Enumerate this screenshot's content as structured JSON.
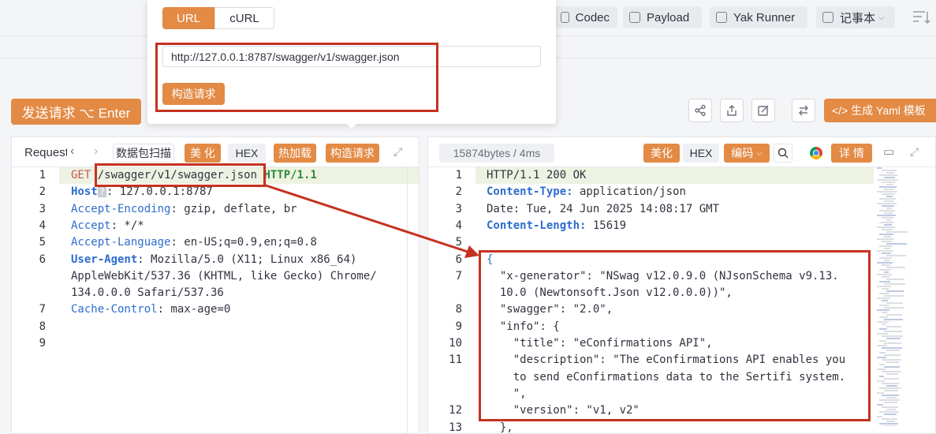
{
  "toolbar": {
    "codec": "Codec",
    "payload": "Payload",
    "yak_runner": "Yak Runner",
    "notebook": "记事本"
  },
  "popup": {
    "tab_url": "URL",
    "tab_curl": "cURL",
    "url_value": "http://127.0.0.1:8787/swagger/v1/swagger.json",
    "build_button": "构造请求"
  },
  "send_button": "发送请求 ⌥ Enter",
  "yaml_button": "</> 生成 Yaml 模板",
  "request_panel": {
    "title": "Request",
    "scan": "数据包扫描",
    "beautify": "美 化",
    "hex": "HEX",
    "hotload": "热加载",
    "build": "构造请求",
    "lines": [
      {
        "n": "1",
        "parts": [
          [
            "GET ",
            "red"
          ],
          [
            "/swagger/v1/swagger.json",
            "plain"
          ],
          [
            " HTTP/1.1",
            "redbold"
          ]
        ]
      },
      {
        "n": "2",
        "parts": [
          [
            "Host",
            "bluebold"
          ],
          [
            "?",
            "badge"
          ],
          [
            ": 127.0.0.1:8787",
            "plain"
          ]
        ]
      },
      {
        "n": "3",
        "parts": [
          [
            "Accept-Encoding",
            "blue"
          ],
          [
            ": gzip, deflate, br",
            "plain"
          ]
        ]
      },
      {
        "n": "4",
        "parts": [
          [
            "Accept",
            "blue"
          ],
          [
            ": */*",
            "plain"
          ]
        ]
      },
      {
        "n": "5",
        "parts": [
          [
            "Accept-Language",
            "blue"
          ],
          [
            ": en-US;q=0.9,en;q=0.8",
            "plain"
          ]
        ]
      },
      {
        "n": "6",
        "parts": [
          [
            "User-Agent",
            "bluebold"
          ],
          [
            ": Mozilla/5.0 (X11; Linux x86_64)",
            "plain"
          ]
        ]
      },
      {
        "n": "",
        "parts": [
          [
            "AppleWebKit/537.36 (KHTML, like Gecko) Chrome/",
            "plain"
          ]
        ]
      },
      {
        "n": "",
        "parts": [
          [
            "134.0.0.0 Safari/537.36",
            "plain"
          ]
        ]
      },
      {
        "n": "7",
        "parts": [
          [
            "Cache-Control",
            "blue"
          ],
          [
            ": max-age=0",
            "plain"
          ]
        ]
      },
      {
        "n": "8",
        "parts": []
      },
      {
        "n": "9",
        "parts": []
      }
    ]
  },
  "response_panel": {
    "size_info": "15874bytes / 4ms",
    "beautify": "美化",
    "hex": "HEX",
    "encode": "编码",
    "details": "详 情",
    "lines": [
      {
        "n": "1",
        "parts": [
          [
            "HTTP/1.1 200 OK",
            "plain"
          ]
        ]
      },
      {
        "n": "2",
        "parts": [
          [
            "Content-Type:",
            "bluebold"
          ],
          [
            " application/json",
            "plain"
          ]
        ]
      },
      {
        "n": "3",
        "parts": [
          [
            "Date: Tue, 24 Jun 2025 14:08:17 GMT",
            "plain"
          ]
        ]
      },
      {
        "n": "4",
        "parts": [
          [
            "Content-Length:",
            "bluebold"
          ],
          [
            " 15619",
            "plain"
          ]
        ]
      },
      {
        "n": "5",
        "parts": []
      },
      {
        "n": "6",
        "parts": [
          [
            "{",
            "blue"
          ]
        ]
      },
      {
        "n": "7",
        "parts": [
          [
            "  \"x-generator\": \"NSwag v12.0.9.0 (NJsonSchema v9.13.",
            "plain"
          ]
        ]
      },
      {
        "n": "",
        "parts": [
          [
            "  10.0 (Newtonsoft.Json v12.0.0.0))\",",
            "plain"
          ]
        ]
      },
      {
        "n": "8",
        "parts": [
          [
            "  \"swagger\": \"2.0\",",
            "plain"
          ]
        ]
      },
      {
        "n": "9",
        "parts": [
          [
            "  \"info\": {",
            "plain"
          ]
        ]
      },
      {
        "n": "10",
        "parts": [
          [
            "    \"title\": \"eConfirmations API\",",
            "plain"
          ]
        ]
      },
      {
        "n": "11",
        "parts": [
          [
            "    \"description\": \"The eConfirmations API enables you",
            "plain"
          ]
        ]
      },
      {
        "n": "",
        "parts": [
          [
            "    to send eConfirmations data to the Sertifi system.",
            "plain"
          ]
        ]
      },
      {
        "n": "",
        "parts": [
          [
            "    \",",
            "plain"
          ]
        ]
      },
      {
        "n": "12",
        "parts": [
          [
            "    \"version\": \"v1, v2\"",
            "plain"
          ]
        ]
      },
      {
        "n": "13",
        "parts": [
          [
            "  },",
            "plain"
          ]
        ]
      }
    ]
  },
  "colors": {
    "accent": "#e38a45",
    "annotation_red": "#c5321f",
    "key_blue": "#2d6ccf",
    "method_red": "#c4564a"
  }
}
